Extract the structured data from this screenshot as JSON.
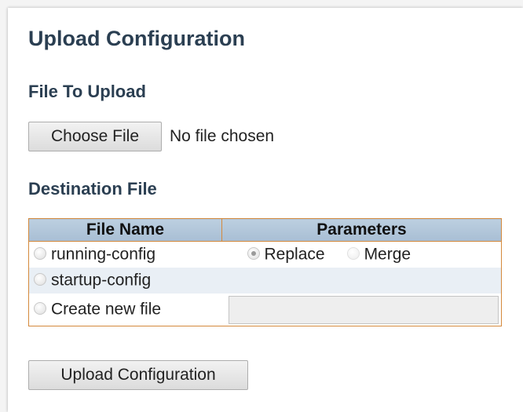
{
  "page": {
    "title": "Upload Configuration",
    "file_section": "File To Upload",
    "destination_section": "Destination File"
  },
  "file_picker": {
    "button_label": "Choose File",
    "status": "No file chosen"
  },
  "destination_table": {
    "headers": [
      "File Name",
      "Parameters"
    ],
    "rows": [
      {
        "file": "running-config",
        "selected": false,
        "params": [
          "Replace",
          "Merge"
        ],
        "param_selected": "Replace"
      },
      {
        "file": "startup-config",
        "selected": false
      },
      {
        "file": "Create new file",
        "selected": false,
        "input_value": ""
      }
    ]
  },
  "actions": {
    "upload_label": "Upload Configuration"
  }
}
